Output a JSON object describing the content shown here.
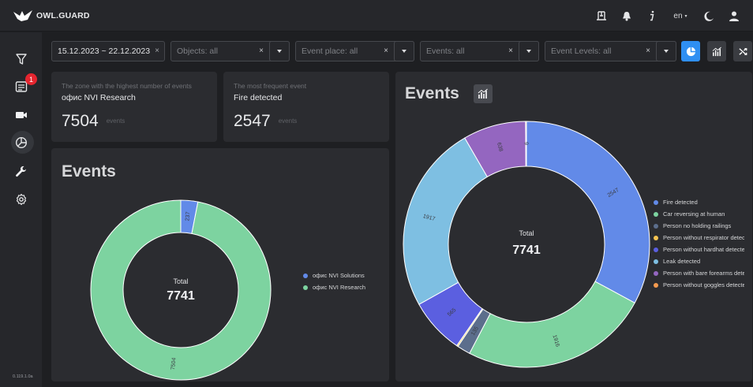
{
  "app": {
    "name": "OWL.GUARD",
    "version": "0.119.1.0a"
  },
  "topbar": {
    "language": "en",
    "icons": [
      "antenna-icon",
      "bell-icon",
      "info-icon",
      "moon-icon",
      "user-icon"
    ]
  },
  "sidebar": {
    "items": [
      {
        "name": "filter",
        "icon": "funnel-icon"
      },
      {
        "name": "events",
        "icon": "list-icon",
        "badge": "1"
      },
      {
        "name": "cameras",
        "icon": "camera-icon"
      },
      {
        "name": "analytics",
        "icon": "pie-chart-icon",
        "active": true
      },
      {
        "name": "tools",
        "icon": "wrench-icon"
      },
      {
        "name": "settings",
        "icon": "gear-icon"
      }
    ]
  },
  "filters": {
    "date_range": "15.12.2023 ~ 22.12.2023",
    "objects": "Objects: all",
    "event_place": "Event place: all",
    "events": "Events: all",
    "event_levels": "Event Levels: all",
    "clear_symbol": "×"
  },
  "view_buttons": [
    {
      "name": "pie",
      "icon": "pie-chart-icon",
      "active": true
    },
    {
      "name": "bar",
      "icon": "bar-chart-icon",
      "active": false
    },
    {
      "name": "shuffle",
      "icon": "shuffle-icon",
      "active": false
    }
  ],
  "stats": {
    "zone": {
      "label": "The zone with the highest number of events",
      "name": "офис NVI Research",
      "value": "7504",
      "unit": "events"
    },
    "frequent": {
      "label": "The most frequent event",
      "name": "Fire detected",
      "value": "2547",
      "unit": "events"
    }
  },
  "colors": {
    "accent": "#2f8ff2",
    "badge": "#e5252f",
    "blue": "#628ae8",
    "green": "#7dd3a0",
    "slate": "#5c6e8c",
    "yellow": "#f5c451",
    "indigo": "#5b5fe0",
    "light_blue": "#7ebfe2",
    "purple": "#9466c0",
    "orange": "#f49a4f"
  },
  "chart_data": [
    {
      "type": "pie",
      "title": "Events",
      "center_label": "Total",
      "total": "7741",
      "series": [
        {
          "name": "офис NVI Solutions",
          "value": 237,
          "label": "237",
          "color": "#628ae8"
        },
        {
          "name": "офис NVI Research",
          "value": 7504,
          "label": "7504",
          "color": "#7dd3a0"
        }
      ],
      "legend": "right"
    },
    {
      "type": "pie",
      "title": "Events",
      "center_label": "Total",
      "total": "7741",
      "series": [
        {
          "name": "Fire detected",
          "value": 2547,
          "label": "2547",
          "color": "#628ae8"
        },
        {
          "name": "Car reversing at human",
          "value": 1916,
          "label": "1916",
          "color": "#7dd3a0"
        },
        {
          "name": "Person no holding railings",
          "value": 135,
          "label": "135",
          "color": "#5c6e8c"
        },
        {
          "name": "Person without respirator detected",
          "value": 14,
          "label": "",
          "color": "#f5c451"
        },
        {
          "name": "Person without hardhat detected",
          "value": 565,
          "label": "565",
          "color": "#5b5fe0"
        },
        {
          "name": "Leak detected",
          "value": 1917,
          "label": "1917",
          "color": "#7ebfe2"
        },
        {
          "name": "Person with bare forearms detected",
          "value": 638,
          "label": "638",
          "color": "#9466c0"
        },
        {
          "name": "Person without goggles detected",
          "value": 9,
          "label": "9",
          "color": "#f49a4f"
        }
      ],
      "legend": "right"
    }
  ]
}
